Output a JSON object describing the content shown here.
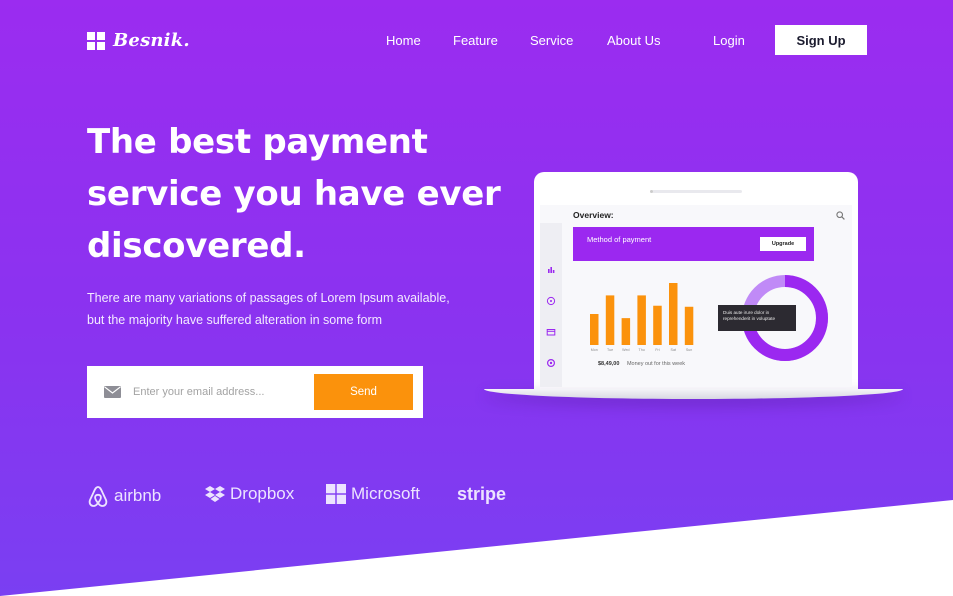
{
  "brand": {
    "name": "Besnik."
  },
  "nav": {
    "home": "Home",
    "feature": "Feature",
    "service": "Service",
    "about": "About Us"
  },
  "auth": {
    "login": "Login",
    "signup": "Sign Up"
  },
  "hero": {
    "title_line1": "The best payment",
    "title_line2": "service you have ever",
    "title_line3": "discovered.",
    "subtitle_line1": "There are many variations of passages of Lorem Ipsum available,",
    "subtitle_line2": "but the majority have suffered alteration in some form"
  },
  "signup_form": {
    "placeholder": "Enter your email address...",
    "send_label": "Send"
  },
  "partners": {
    "airbnb": "airbnb",
    "dropbox": "Dropbox",
    "microsoft": "Microsoft",
    "stripe": "stripe"
  },
  "dashboard": {
    "title": "Overview:",
    "banner_label": "Method of payment",
    "upgrade_label": "Upgrade",
    "tooltip": "Duis aute irure dolor in reprehenderit in voluptate",
    "money_value": "$8,49,00",
    "money_caption": "Money out for this week"
  },
  "chart_data": {
    "type": "bar",
    "categories": [
      "Mon",
      "Tue",
      "Wed",
      "Thu",
      "Fri",
      "Sat",
      "Sun"
    ],
    "values": [
      30,
      48,
      26,
      48,
      38,
      60,
      37
    ],
    "ylim": [
      0,
      60
    ]
  },
  "donut": {
    "progress": 0.75
  },
  "colors": {
    "accent": "#9b28f0",
    "orange": "#fb920c",
    "background": "#8a33f0"
  },
  "icons": {
    "mail": "mail-icon",
    "search": "search-icon",
    "logo": "grid-logo-icon"
  }
}
